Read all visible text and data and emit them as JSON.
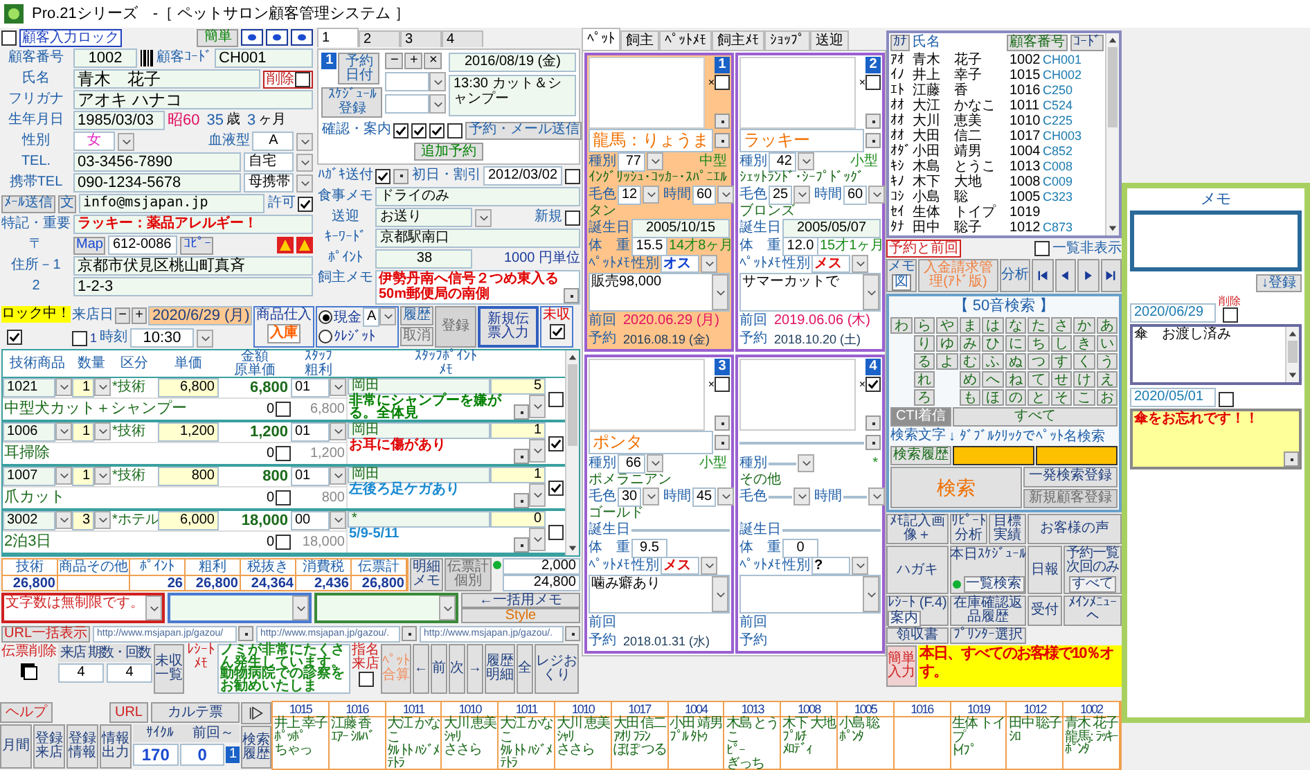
{
  "window": {
    "title": "Pro.21シリーズ　-［ ペットサロン顧客管理システム ］"
  },
  "customer": {
    "lock_label": "顧客入力ロック",
    "lock_checked": false,
    "simple_button": "簡単",
    "number_label": "顧客番号",
    "number": "1002",
    "code_label": "顧客ｺｰﾄﾞ",
    "code": "CH001",
    "name_label": "氏名",
    "name": "青木　花子",
    "delete_label": "削除",
    "delete_checked": false,
    "kana_label": "フリガナ",
    "kana": "アオキ ハナコ",
    "birth_label": "生年月日",
    "birth": "1985/03/03",
    "era": "昭60",
    "age": "35",
    "age_unit": "歳",
    "months": "3",
    "months_unit": "ヶ月",
    "gender_label": "性別",
    "gender": "女",
    "blood_label": "血液型",
    "blood": "A",
    "tel_label": "TEL.",
    "tel": "03-3456-7890",
    "tel_kind": "自宅",
    "mobile_label": "携帯TEL",
    "mobile": "090-1234-5678",
    "mobile_kind": "母携帯",
    "mail_button": "ﾒｰﾙ送信",
    "text_button": "文",
    "email": "info@msjapan.jp",
    "permit_label": "許可",
    "permit_checked": true,
    "notes_label": "特記・重要",
    "notes": "ラッキー：薬品アレルギー！",
    "zip_label": "〒",
    "map_button": "Map",
    "zip": "612-0086",
    "copy_button": "ｺﾋﾟｰ",
    "address1_label": "住所－1",
    "address1": "京都市伏見区桃山町真斉",
    "address2_label": "2",
    "address2": "1-2-3"
  },
  "reservation": {
    "tabs": [
      {
        "label": "1",
        "selected": true
      },
      {
        "label": "2",
        "selected": false
      },
      {
        "label": "3",
        "selected": false
      },
      {
        "label": "4",
        "selected": false
      }
    ],
    "number": "1",
    "date_button": "予約日付",
    "schedule_button": "ｽｹｼﾞｭｰﾙ登録",
    "step_buttons": [
      "−",
      "+",
      "×"
    ],
    "date": "2016/08/19 (金)",
    "detail": "13:30 カット＆シャンプー",
    "confirm_label": "確認・案内",
    "confirms": [
      {
        "checked": true
      },
      {
        "checked": true
      },
      {
        "checked": true
      },
      {
        "checked": false
      }
    ],
    "send_button": "予約・メール送信",
    "add_button": "追加予約"
  },
  "owner": {
    "postcard_label": "ﾊｶﾞｷ送付",
    "postcard_checked": true,
    "first_label": "初日・割引",
    "first_date": "2012/03/02",
    "first_checked": false,
    "meal_label": "食事メモ",
    "meal": "ドライのみ",
    "pickup_label": "送迎",
    "pickup": "お送り",
    "new_label": "新規",
    "new_checked": false,
    "keyword_label": "ｷｰﾜｰﾄﾞ",
    "keyword": "京都駅南口",
    "point_label": "ﾎﾟｲﾝﾄ",
    "points": "38",
    "point_unit": "1000 円単位",
    "memo_label": "飼主メモ",
    "memo": "伊勢丹南へ信号２つめ東入る50m郵便局の南側"
  },
  "visit": {
    "lock_label": "ロック中！",
    "lock_checked": true,
    "date_label": "来店日",
    "minus": "−",
    "plus": "+",
    "date": "2020/6/29 (月)",
    "time_checked": false,
    "time_index": "1",
    "time_label": "時刻",
    "time": "10:30",
    "stock_label": "商品仕入",
    "stock_button": "入庫",
    "payments": [
      {
        "label": "現金",
        "selected": true
      },
      {
        "label": "ｸﾚｼﾞｯﾄ",
        "selected": false
      }
    ],
    "pay_class": "A",
    "history_button": "履歴",
    "cancel_button": "取消",
    "register_button": "登録",
    "new_slip_button": "新規伝票入力",
    "unpaid_label": "未収",
    "unpaid_checked": true
  },
  "sales": {
    "columns": [
      {
        "top": "技術商品"
      },
      {
        "top": "数量"
      },
      {
        "top": "区分"
      },
      {
        "top": "単価"
      },
      {
        "top": "金額",
        "bottom": "原単価"
      },
      {
        "top": "ｽﾀｯﾌ",
        "bottom": "粗利"
      },
      {
        "top": "ｽﾀｯﾌﾎﾟｲﾝﾄ",
        "bottom": "ﾒﾓ"
      }
    ],
    "rows": [
      {
        "code": "1021",
        "qty": "1",
        "kind": "*技術",
        "price": "6,800",
        "amount": "6,800",
        "staff_code": "01",
        "staff": "岡田",
        "points": "5",
        "name": "中型犬カット＋シャンプー",
        "cost": "0",
        "cost_checked": false,
        "profit": "6,800",
        "memo": "非常にシャンプーを嫌がる。全体見",
        "color": "#008000",
        "checked": false
      },
      {
        "code": "1006",
        "qty": "1",
        "kind": "*技術",
        "price": "1,200",
        "amount": "1,200",
        "staff_code": "01",
        "staff": "岡田",
        "points": "1",
        "name": "耳掃除",
        "cost": "0",
        "cost_checked": false,
        "profit": "1,200",
        "memo": "お耳に傷があり",
        "color": "#e00000",
        "checked": true
      },
      {
        "code": "1007",
        "qty": "1",
        "kind": "*技術",
        "price": "800",
        "amount": "800",
        "staff_code": "01",
        "staff": "岡田",
        "points": "1",
        "name": "爪カット",
        "cost": "0",
        "cost_checked": false,
        "profit": "800",
        "memo": "左後ろ足ケガあり",
        "color": "#1a8ad0",
        "checked": true
      },
      {
        "code": "3002",
        "qty": "3",
        "kind": "*ホテル",
        "price": "6,000",
        "amount": "18,000",
        "staff_code": "00",
        "staff": "*",
        "points": "0",
        "name": "2泊3日",
        "cost": "0",
        "cost_checked": false,
        "profit": "18,000",
        "memo": "5/9-5/11",
        "color": "#1a8ad0",
        "checked": false
      }
    ],
    "totals": [
      {
        "label": "技術",
        "value": "26,800"
      },
      {
        "label": "商品その他"
      },
      {
        "label": "ﾎﾟｲﾝﾄ",
        "value": "26"
      },
      {
        "label": "粗利",
        "value": "26,800"
      },
      {
        "label": "税抜き",
        "value": "24,364"
      },
      {
        "label": "消費税",
        "value": "2,436"
      },
      {
        "label": "伝票計",
        "value": "26,800"
      }
    ],
    "detail_memo_button": "明細メモ",
    "slip_total_button": "伝票計個別",
    "amount_1": "2,000",
    "amount_2": "24,800"
  },
  "memo_boxes": [
    {
      "text": "文字数は無制限です。",
      "color": "#d02020"
    },
    {
      "color": "#4a7ad0"
    },
    {
      "color": "#3a8a3a"
    }
  ],
  "memo_buttons": [
    "←一括用メモ",
    "Style"
  ],
  "links": {
    "url_button": "URL一括表示",
    "urls": [
      "http://www.msjapan.jp/gazou/",
      "http://www.msjapan.jp/gazou/.",
      "http://www.msjapan.jp/gazou/."
    ]
  },
  "slip": {
    "delete_label": "伝票削除",
    "delete_checked": true,
    "count_label": "来店 期数・回数",
    "counts": [
      "4",
      "4"
    ],
    "unpaid_list_button": "未収一覧",
    "receipt_label": "ﾚｼｰﾄﾒﾓ",
    "receipt_memo": "ノミが非常にたくさん発生しています。動物病院での診察をお勧めいたしま",
    "designated_label": "指名来店",
    "designated_checked": false,
    "pet_total_button": "ﾍﾟｯﾄ合算",
    "nav_buttons": [
      "←",
      "前",
      "次",
      "→",
      "履歴明細",
      "全",
      "レジおくり"
    ]
  },
  "footer": {
    "help_button": "ヘルプ",
    "url_button": "URL",
    "chart_button": "カルテ票",
    "buttons": [
      "月間",
      "登録来店",
      "登録情報",
      "情報出力"
    ],
    "cycle_label": "ｻｲｸﾙ",
    "prev_label": "前回～",
    "cycle": "170",
    "prev": "0",
    "page": "1",
    "history_button": "検索履歴"
  },
  "schedule": [
    {
      "code": "1015",
      "name": "井上 幸子",
      "pets": [
        "ﾎﾟｯﾎﾟ",
        "ちゃっ"
      ]
    },
    {
      "code": "1016",
      "name": "江藤 香",
      "pets": [
        "ｴｱｰ",
        "ｼﾙﾊﾞ"
      ]
    },
    {
      "code": "1011",
      "name": "大江 かなこ",
      "pets": [
        "ﾀﾙ",
        "ﾄﾄ",
        "ﾊｼﾞﾒ",
        "ﾃﾄﾗ"
      ]
    },
    {
      "code": "1010",
      "name": "大川 恵美",
      "pets": [
        "ｼｬﾘ",
        "ささら"
      ]
    },
    {
      "code": "1011",
      "name": "大江 かなこ",
      "pets": [
        "ﾀﾙ",
        "ﾄﾄ",
        "ﾊｼﾞﾒ",
        "ﾃﾄﾗ"
      ]
    },
    {
      "code": "1010",
      "name": "大川 恵美",
      "pets": [
        "ｼｬﾘ",
        "ささら"
      ]
    },
    {
      "code": "1017",
      "name": "大田 信二",
      "pets": [
        "ｱｵﾘ",
        "ﾌﾗﾝ",
        "ぽぽ",
        "つる"
      ]
    },
    {
      "code": "1004",
      "name": "小田 靖男",
      "pets": [
        "ﾌﾟﾙ",
        "ﾀﾄｩ"
      ]
    },
    {
      "code": "1013",
      "name": "木島 とうこ",
      "pets": [
        "ﾋﾟｰ",
        "ぎっち"
      ]
    },
    {
      "code": "1008",
      "name": "木下 大地",
      "pets": [
        "ﾌﾟﾙﾁ",
        "ﾒﾛﾃﾞｨ"
      ]
    },
    {
      "code": "1005",
      "name": "小島 聡",
      "pets": [
        "ﾎﾟﾝﾀ"
      ]
    },
    {
      "code": "1016"
    },
    {
      "code": "1019",
      "name": "生体 トイプ",
      "pets": [
        "ﾄｲﾌﾟ"
      ]
    },
    {
      "code": "1012",
      "name": "田中 聡子",
      "pets": [
        "ｼﾛ"
      ]
    },
    {
      "code": "1002",
      "name": "青木 花子",
      "pets": [
        "龍馬:",
        "ﾗｯｷｰ",
        "ﾎﾟﾝﾀ"
      ]
    }
  ],
  "pet_tabs": [
    {
      "label": "ﾍﾟｯﾄ",
      "selected": true
    },
    {
      "label": "飼主",
      "selected": false
    },
    {
      "label": "ﾍﾟｯﾄﾒﾓ",
      "selected": false
    },
    {
      "label": "飼主ﾒﾓ",
      "selected": false
    },
    {
      "label": "ｼｮｯﾌﾟ",
      "selected": false
    },
    {
      "label": "送迎",
      "selected": false
    }
  ],
  "pets": [
    {
      "selected": true,
      "number": "1",
      "remove_label": "×",
      "removed": false,
      "name": "龍馬：りょうま",
      "species_label": "種別",
      "species": "77",
      "size": "中型",
      "breed": "ｲﾝｸﾞﾘｯｼｭ･ｺｯｶｰ･ｽﾊﾟﾆｴﾙ",
      "coat_label": "毛色",
      "coat_code": "12",
      "time_label": "時間",
      "time": "60",
      "coat": "タン",
      "birth_label": "誕生日",
      "birth": "2005/10/15",
      "weight_label": "体　重",
      "weight": "15.5",
      "age": "14才8ヶ月",
      "memo_label": "ﾍﾟｯﾄﾒﾓ",
      "gender_label": "性別",
      "gender": {
        "label": "オス",
        "color": "#1040d0"
      },
      "memo": "販売98,000",
      "prev_label": "前回",
      "prev": "2020.06.29 (月)",
      "next_label": "予約",
      "next": "2016.08.19 (金)"
    },
    {
      "selected": false,
      "number": "2",
      "remove_label": "×",
      "removed": false,
      "name": "ラッキー",
      "species_label": "種別",
      "species": "42",
      "size": "小型",
      "breed": "ｼｪｯﾄﾗﾝﾄﾞ･ｼｰﾌﾟﾄﾞｯｸﾞ",
      "coat_label": "毛色",
      "coat_code": "25",
      "time_label": "時間",
      "time": "60",
      "coat": "ブロンズ",
      "birth_label": "誕生日",
      "birth": "2005/05/07",
      "weight_label": "体　重",
      "weight": "12.0",
      "age": "15才1ヶ月",
      "memo_label": "ﾍﾟｯﾄﾒﾓ",
      "gender_label": "性別",
      "gender": {
        "label": "メス",
        "color": "#e01010"
      },
      "memo": "サマーカットで",
      "prev_label": "前回",
      "prev": "2019.06.06 (木)",
      "next_label": "予約",
      "next": "2018.10.20 (土)"
    },
    {
      "selected": false,
      "number": "3",
      "remove_label": "×",
      "removed": false,
      "name": "ポンタ",
      "species_label": "種別",
      "species": "66",
      "size": "小型",
      "breed": "ポメラニアン",
      "coat_label": "毛色",
      "coat_code": "30",
      "time_label": "時間",
      "time": "45",
      "coat": "ゴールド",
      "birth_label": "誕生日",
      "weight_label": "体　重",
      "weight": "9.5",
      "memo_label": "ﾍﾟｯﾄﾒﾓ",
      "gender_label": "性別",
      "gender": {
        "label": "メス",
        "color": "#e01010"
      },
      "memo": "噛み癖あり",
      "prev_label": "前回",
      "next_label": "予約",
      "next": "2018.01.31 (水)"
    },
    {
      "selected": false,
      "number": "4",
      "remove_label": "×",
      "removed": true,
      "species_label": "種別",
      "size": "*",
      "breed": "その他",
      "coat_label": "毛色",
      "time_label": "時間",
      "birth_label": "誕生日",
      "weight_label": "体　重",
      "weight": "0",
      "memo_label": "ﾍﾟｯﾄﾒﾓ",
      "gender_label": "性別",
      "gender": {
        "label": "?",
        "color": "#000000"
      },
      "prev_label": "前回",
      "next_label": "予約"
    }
  ],
  "customer_list": {
    "headers": [
      "ｶﾅ",
      "氏名",
      "顧客番号",
      "ｺｰﾄﾞ"
    ],
    "rows": [
      {
        "kana": "ｱｵ",
        "name": "青木　花子",
        "number": "1002",
        "code": "CH001"
      },
      {
        "kana": "ｲﾉ",
        "name": "井上　幸子",
        "number": "1015",
        "code": "CH002"
      },
      {
        "kana": "ｴﾄ",
        "name": "江藤　香",
        "number": "1016",
        "code": "C250"
      },
      {
        "kana": "ｵｵ",
        "name": "大江　かなこ",
        "number": "1011",
        "code": "C524"
      },
      {
        "kana": "ｵｵ",
        "name": "大川　恵美",
        "number": "1010",
        "code": "C225"
      },
      {
        "kana": "ｵｵ",
        "name": "大田　信二",
        "number": "1017",
        "code": "CH003"
      },
      {
        "kana": "ｵﾀﾞ",
        "name": "小田　靖男",
        "number": "1004",
        "code": "C852"
      },
      {
        "kana": "ｷｼ",
        "name": "木島　とうこ",
        "number": "1013",
        "code": "C008"
      },
      {
        "kana": "ｷﾉ",
        "name": "木下　大地",
        "number": "1008",
        "code": "C009"
      },
      {
        "kana": "ｺｼ",
        "name": "小島　聡",
        "number": "1005",
        "code": "C323"
      },
      {
        "kana": "ｾｲ",
        "name": "生体　トイプ",
        "number": "1019"
      },
      {
        "kana": "ﾀﾅ",
        "name": "田中　聡子",
        "number": "1012",
        "code": "C873"
      }
    ],
    "reserve_label": "予約と前回",
    "hide_label": "一覧非表示",
    "hide_checked": false,
    "memo_button": "メモ",
    "memo_sub": "図",
    "billing_button": "入金請求管理(ｱﾄﾞ版)",
    "analysis_button": "分析"
  },
  "search": {
    "title": "【 50音検索 】",
    "columns": [
      [
        "わ"
      ],
      [
        "ら",
        "り",
        "る",
        "れ",
        "ろ"
      ],
      [
        "や",
        "ゆ",
        "よ"
      ],
      [
        "ま",
        "み",
        "む",
        "め",
        "も"
      ],
      [
        "は",
        "ひ",
        "ふ",
        "へ",
        "ほ"
      ],
      [
        "な",
        "に",
        "ぬ",
        "ね",
        "の"
      ],
      [
        "た",
        "ち",
        "つ",
        "て",
        "と"
      ],
      [
        "さ",
        "し",
        "す",
        "せ",
        "そ"
      ],
      [
        "か",
        "き",
        "く",
        "け",
        "こ"
      ],
      [
        "あ",
        "い",
        "う",
        "え",
        "お"
      ]
    ],
    "cti_button": "CTI着信",
    "all_button": "すべて",
    "text_label": "検索文字",
    "hint": "↓ ﾀﾞﾌﾞﾙｸﾘｯｸでﾍﾟｯﾄ名検索",
    "history_button": "検索履歴",
    "search_button": "検索",
    "quick_button": "一発検索登録",
    "new_button": "新規顧客登録"
  },
  "menu": {
    "memo_image": "ﾒﾓ記入画像＋",
    "repeat": "ﾘﾋﾟｰﾄ分析",
    "target": "目標実績",
    "voice": "お客様の声",
    "postcard": "ハガキ",
    "today_label": "本日ｽｹｼﾞｭｰﾙ",
    "list_search": "一覧検索",
    "daily": "日報",
    "reserve_list": "予約一覧次回のみ",
    "reserve_all": "すべて",
    "receipt": "ﾚｼｰﾄ (F.4)",
    "guide": "案内",
    "stock": "在庫確認返品履歴",
    "reception": "受付",
    "main_menu": "ﾒｲﾝﾒﾆｭｰへ",
    "invoice": "領収書",
    "printer": "ﾌﾟﾘﾝﾀｰ選択"
  },
  "notice": {
    "button": "簡単入力",
    "lines": [
      "本日、すべてのお客様で10％オ",
      "す。"
    ]
  },
  "memo_panel": {
    "title": "メモ",
    "save_button": "↓登録",
    "delete_label": "削除",
    "entries": [
      {
        "date": "2020/06/29",
        "checked": false,
        "text": "傘　お渡し済み",
        "kind": "note"
      },
      {
        "date": "2020/05/01",
        "checked": false,
        "text": "傘をお忘れです！！",
        "kind": "alert"
      }
    ]
  }
}
